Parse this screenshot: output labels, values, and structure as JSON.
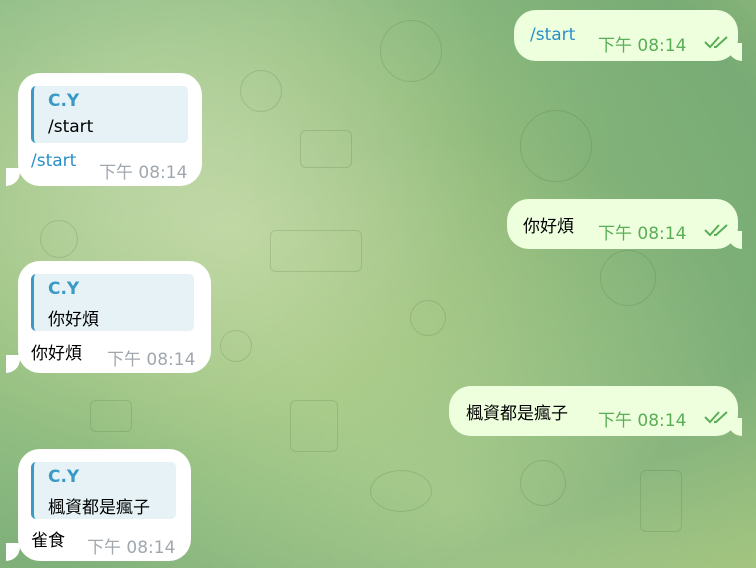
{
  "messages": [
    {
      "id": "m1",
      "direction": "out",
      "text": "/start",
      "time": "下午 08:14",
      "is_command": true
    },
    {
      "id": "m2",
      "direction": "in",
      "reply_name": "C.Y",
      "reply_text": "/start",
      "text": "/start",
      "time": "下午 08:14",
      "is_command": true
    },
    {
      "id": "m3",
      "direction": "out",
      "text": "你好煩",
      "time": "下午 08:14"
    },
    {
      "id": "m4",
      "direction": "in",
      "reply_name": "C.Y",
      "reply_text": "你好煩",
      "text": "你好煩",
      "time": "下午 08:14"
    },
    {
      "id": "m5",
      "direction": "out",
      "text": "楓資都是瘋子",
      "time": "下午 08:14"
    },
    {
      "id": "m6",
      "direction": "in",
      "reply_name": "C.Y",
      "reply_text": "楓資都是瘋子",
      "text": "雀食",
      "time": "下午 08:14"
    }
  ],
  "colors": {
    "outgoing_bubble": "#eeffde",
    "incoming_bubble": "#ffffff",
    "accent": "#3a9ac6",
    "read_check": "#5aae57"
  }
}
